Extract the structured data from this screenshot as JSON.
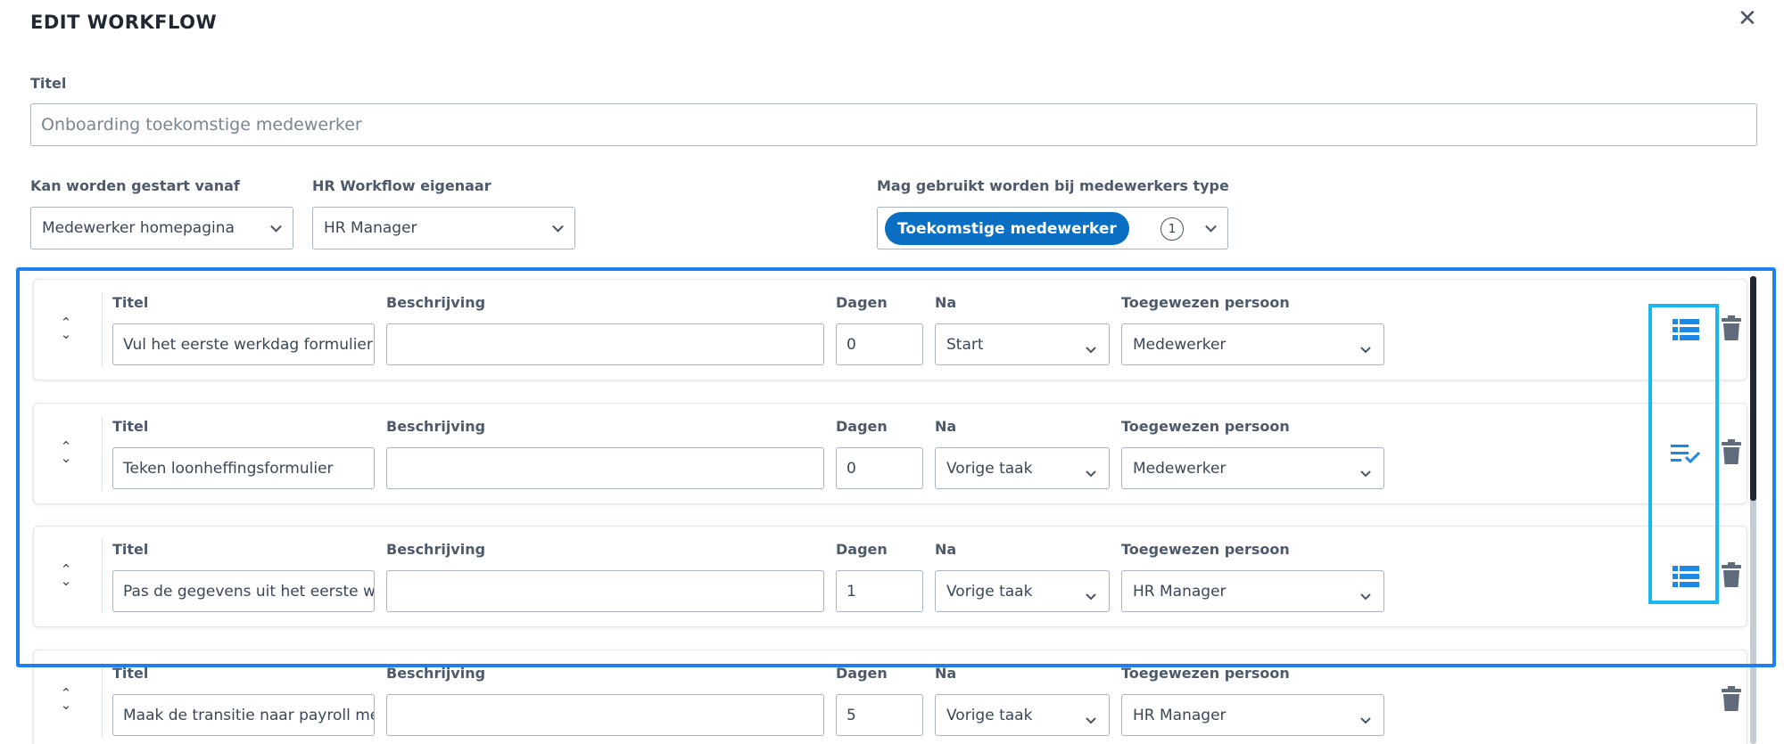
{
  "header": {
    "title": "EDIT WORKFLOW",
    "close_icon": "close-icon"
  },
  "form": {
    "title_label": "Titel",
    "title_value": "Onboarding toekomstige medewerker",
    "start_label": "Kan worden gestart vanaf",
    "start_value": "Medewerker homepagina",
    "owner_label": "HR Workflow eigenaar",
    "owner_value": "HR Manager",
    "types_label": "Mag gebruikt worden bij medewerkers type",
    "types_chip": "Toekomstige medewerker",
    "types_count": "1"
  },
  "task_labels": {
    "title": "Titel",
    "description": "Beschrijving",
    "days": "Dagen",
    "after": "Na",
    "assignee": "Toegewezen persoon"
  },
  "tasks": [
    {
      "title": "Vul het eerste werkdag formulier",
      "description": "",
      "days": "0",
      "after": "Start",
      "assignee": "Medewerker",
      "action_icon": "form-list-icon"
    },
    {
      "title": "Teken loonheffingsformulier",
      "description": "",
      "days": "0",
      "after": "Vorige taak",
      "assignee": "Medewerker",
      "action_icon": "checklist-icon"
    },
    {
      "title": "Pas de gegevens uit het eerste werk",
      "description": "",
      "days": "1",
      "after": "Vorige taak",
      "assignee": "HR Manager",
      "action_icon": "form-list-icon"
    },
    {
      "title": "Maak de transitie naar payroll mede",
      "description": "",
      "days": "5",
      "after": "Vorige taak",
      "assignee": "HR Manager",
      "action_icon": ""
    }
  ],
  "colors": {
    "accent": "#0a6fc2",
    "icon_blue": "#1e88e5",
    "highlight_outline": "#1e7ff0",
    "highlight_inner": "#1ab6ee",
    "trash": "#5f6b7a"
  }
}
